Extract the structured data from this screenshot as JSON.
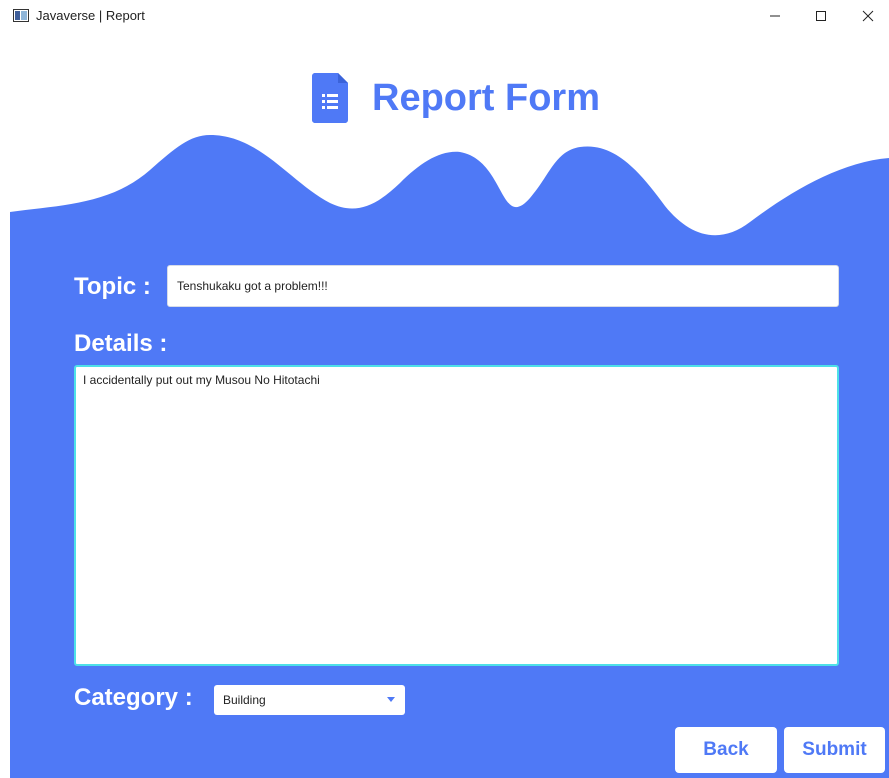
{
  "window": {
    "title": "Javaverse | Report"
  },
  "header": {
    "title": "Report Form",
    "icon": "document-icon"
  },
  "form": {
    "topic_label": "Topic :",
    "topic_value": "Tenshukaku got a problem!!!",
    "details_label": "Details :",
    "details_value": "I accidentally put out my Musou No Hitotachi",
    "category_label": "Category :",
    "category_value": "Building"
  },
  "buttons": {
    "back": "Back",
    "submit": "Submit"
  },
  "colors": {
    "accent": "#4f79f6",
    "focus_border": "#4ee0e8",
    "background": "#ffffff"
  }
}
